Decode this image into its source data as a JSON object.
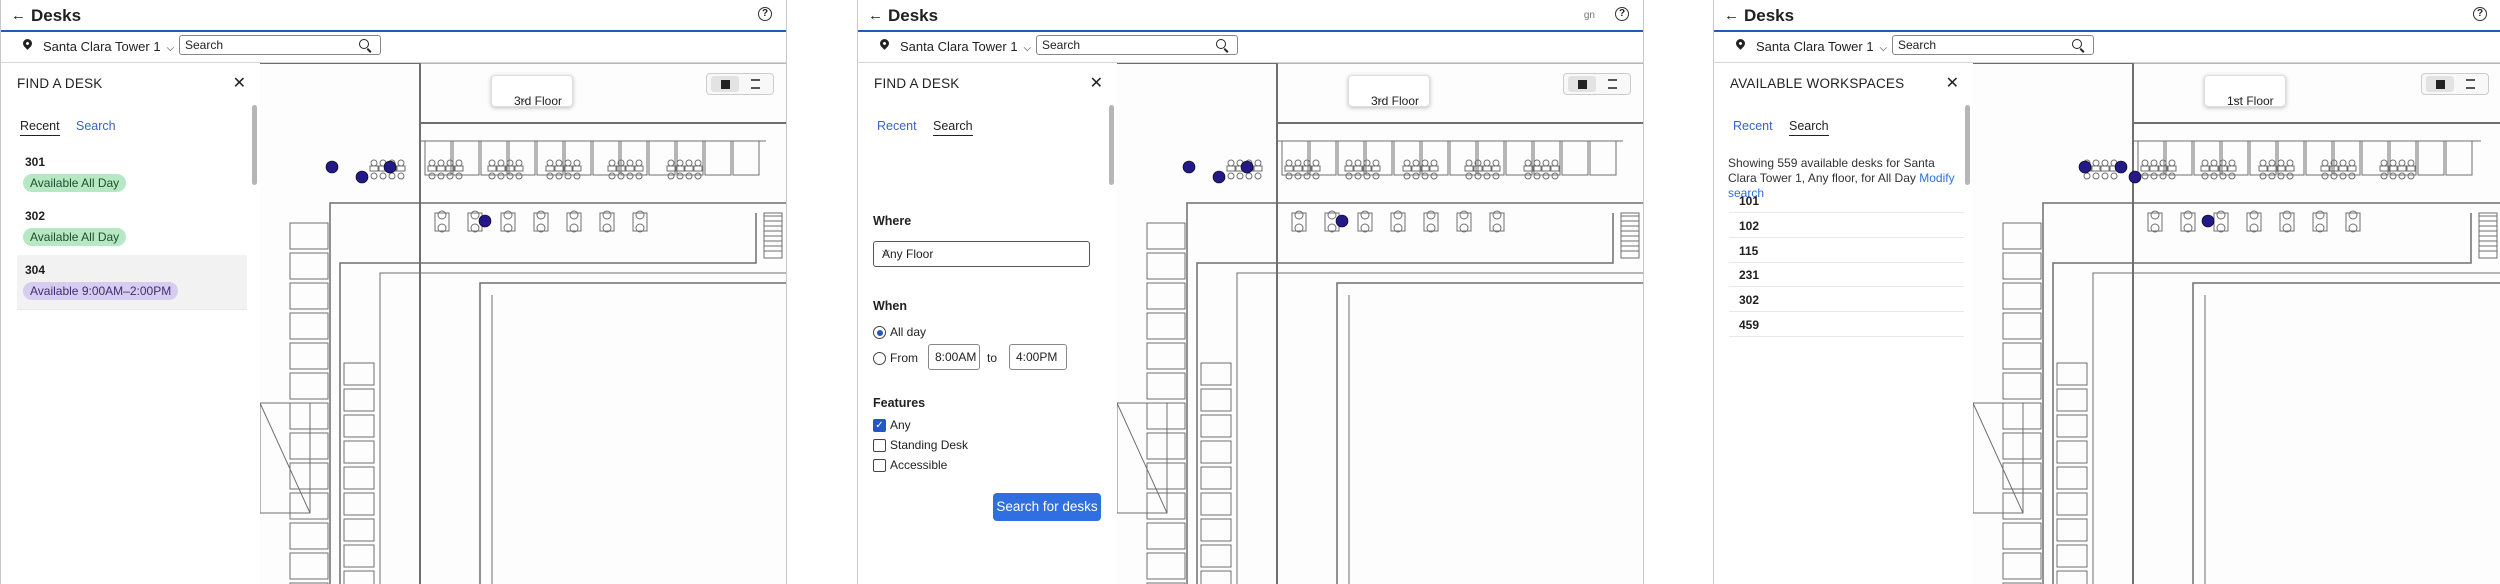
{
  "colors": {
    "accent": "#2457c5",
    "button": "#2f6fe0",
    "desk_dot": "#241a87",
    "available": "#b6e8c4",
    "partial": "#d7cdf0"
  },
  "common": {
    "app_title": "Desks",
    "building": "Santa Clara Tower 1",
    "search_placeholder": "Search",
    "icons": {
      "back": "arrow-left-icon",
      "help": "question-circle-icon",
      "location": "location-pin-icon",
      "search": "magnifier-icon",
      "close": "x-icon",
      "map": "map-icon",
      "list": "list-icon"
    }
  },
  "panel1": {
    "sidebar_title": "FIND A DESK",
    "tabs": [
      "Recent",
      "Search"
    ],
    "active_tab": "Recent",
    "floor": "3rd Floor",
    "recent": [
      {
        "number": "301",
        "status": "Available All Day"
      },
      {
        "number": "302",
        "status": "Available All Day"
      },
      {
        "number": "304",
        "status": "Available 9:00AM–2:00PM"
      }
    ]
  },
  "panel2": {
    "header_text": "gn",
    "sidebar_title": "FIND A DESK",
    "tabs": [
      "Recent",
      "Search"
    ],
    "active_tab": "Search",
    "floor": "3rd Floor",
    "where_label": "Where",
    "where_value": "Any Floor",
    "when_label": "When",
    "all_day": "All day",
    "from_label": "From",
    "from_time": "8:00AM",
    "to_label": "to",
    "to_time": "4:00PM",
    "features_label": "Features",
    "features": [
      {
        "label": "Any",
        "checked": true
      },
      {
        "label": "Standing Desk",
        "checked": false
      },
      {
        "label": "Accessible",
        "checked": false
      }
    ],
    "search_button": "Search for desks"
  },
  "panel3": {
    "sidebar_title": "AVAILABLE WORKSPACES",
    "tabs": [
      "Recent",
      "Search"
    ],
    "active_tab": "Search",
    "floor": "1st Floor",
    "summary": "Showing 559 available desks for Santa Clara Tower 1, Any floor, for All Day",
    "modify_link": "Modify search",
    "results": [
      "101",
      "102",
      "115",
      "231",
      "302",
      "459"
    ]
  }
}
